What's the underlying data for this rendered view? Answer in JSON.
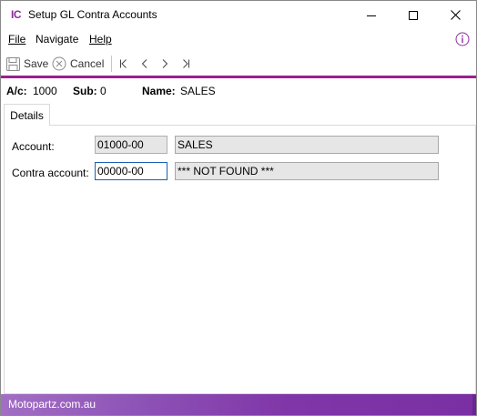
{
  "window": {
    "app_icon": "IC",
    "title": "Setup GL Contra Accounts",
    "controls": [
      "minimize-icon",
      "maximize-icon",
      "close-icon"
    ]
  },
  "menu": {
    "file": "File",
    "navigate": "Navigate",
    "help": "Help",
    "info_icon": "info-icon"
  },
  "toolbar": {
    "save_label": "Save",
    "cancel_label": "Cancel",
    "nav_icons": [
      "first-record-icon",
      "previous-record-icon",
      "next-record-icon",
      "last-record-icon"
    ]
  },
  "header": {
    "ac_label": "A/c:",
    "ac_value": "1000",
    "sub_label": "Sub:",
    "sub_value": "0",
    "name_label": "Name:",
    "name_value": "SALES"
  },
  "tabs": [
    {
      "label": "Details",
      "active": true
    }
  ],
  "form": {
    "account_label": "Account:",
    "account_code": "01000-00",
    "account_name": "SALES",
    "contra_label": "Contra account:",
    "contra_code": "00000-00",
    "contra_name": "*** NOT FOUND ***"
  },
  "status": {
    "text": "Motopartz.com.au"
  },
  "colors": {
    "accent": "#9b1f8e",
    "status_bar": "#8036a8",
    "icon": "#8c2c9c"
  }
}
